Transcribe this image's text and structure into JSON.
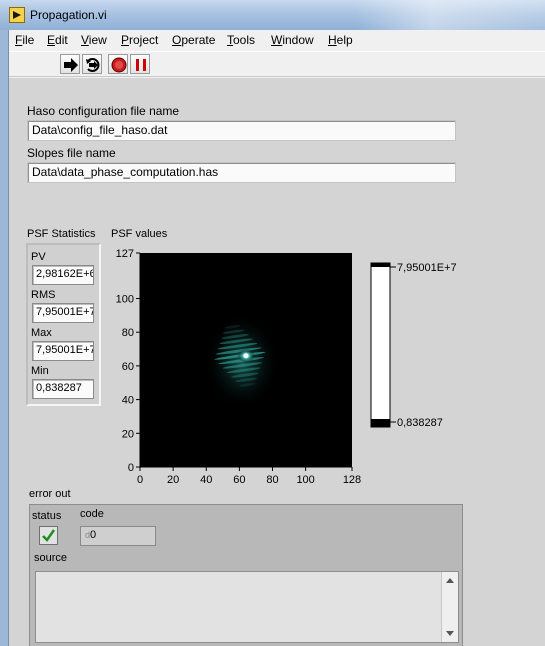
{
  "window": {
    "title": "Propagation.vi"
  },
  "menu": [
    {
      "label": "File"
    },
    {
      "label": "Edit"
    },
    {
      "label": "View"
    },
    {
      "label": "Project"
    },
    {
      "label": "Operate"
    },
    {
      "label": "Tools"
    },
    {
      "label": "Window"
    },
    {
      "label": "Help"
    }
  ],
  "toolbar": {
    "run": "run-arrow-icon",
    "run_continuously": "run-continuously-icon",
    "abort": "abort-stop-icon",
    "pause": "pause-icon"
  },
  "haso": {
    "label": "Haso configuration file name",
    "value": "Data\\config_file_haso.dat"
  },
  "slopes": {
    "label": "Slopes file name",
    "value": "Data\\data_phase_computation.has"
  },
  "psf_stats": {
    "label": "PSF Statistics",
    "pv": {
      "label": "PV",
      "value": "2,98162E+6"
    },
    "rms": {
      "label": "RMS",
      "value": "7,95001E+7"
    },
    "max": {
      "label": "Max",
      "value": "7,95001E+7"
    },
    "min": {
      "label": "Min",
      "value": "0,838287"
    }
  },
  "chart_data": {
    "type": "heatmap",
    "title": "PSF values",
    "x_ticks": [
      "0",
      "20",
      "40",
      "60",
      "80",
      "100",
      "128"
    ],
    "y_ticks": [
      "0",
      "20",
      "40",
      "60",
      "80",
      "100",
      "127"
    ],
    "xlim": [
      0,
      128
    ],
    "ylim": [
      0,
      127
    ],
    "peak": {
      "x": 64,
      "y": 66
    },
    "colormap_hi": "#ffffff",
    "colormap_mid": "#2fa39a",
    "colormap_lo": "#000000",
    "scale_max": "7,95001E+7",
    "scale_min": "0,838287"
  },
  "error_out": {
    "label": "error out",
    "status_label": "status",
    "code_label": "code",
    "code_value": "0",
    "code_prefix": "d",
    "source_label": "source",
    "status_icon": "checkmark-icon"
  }
}
